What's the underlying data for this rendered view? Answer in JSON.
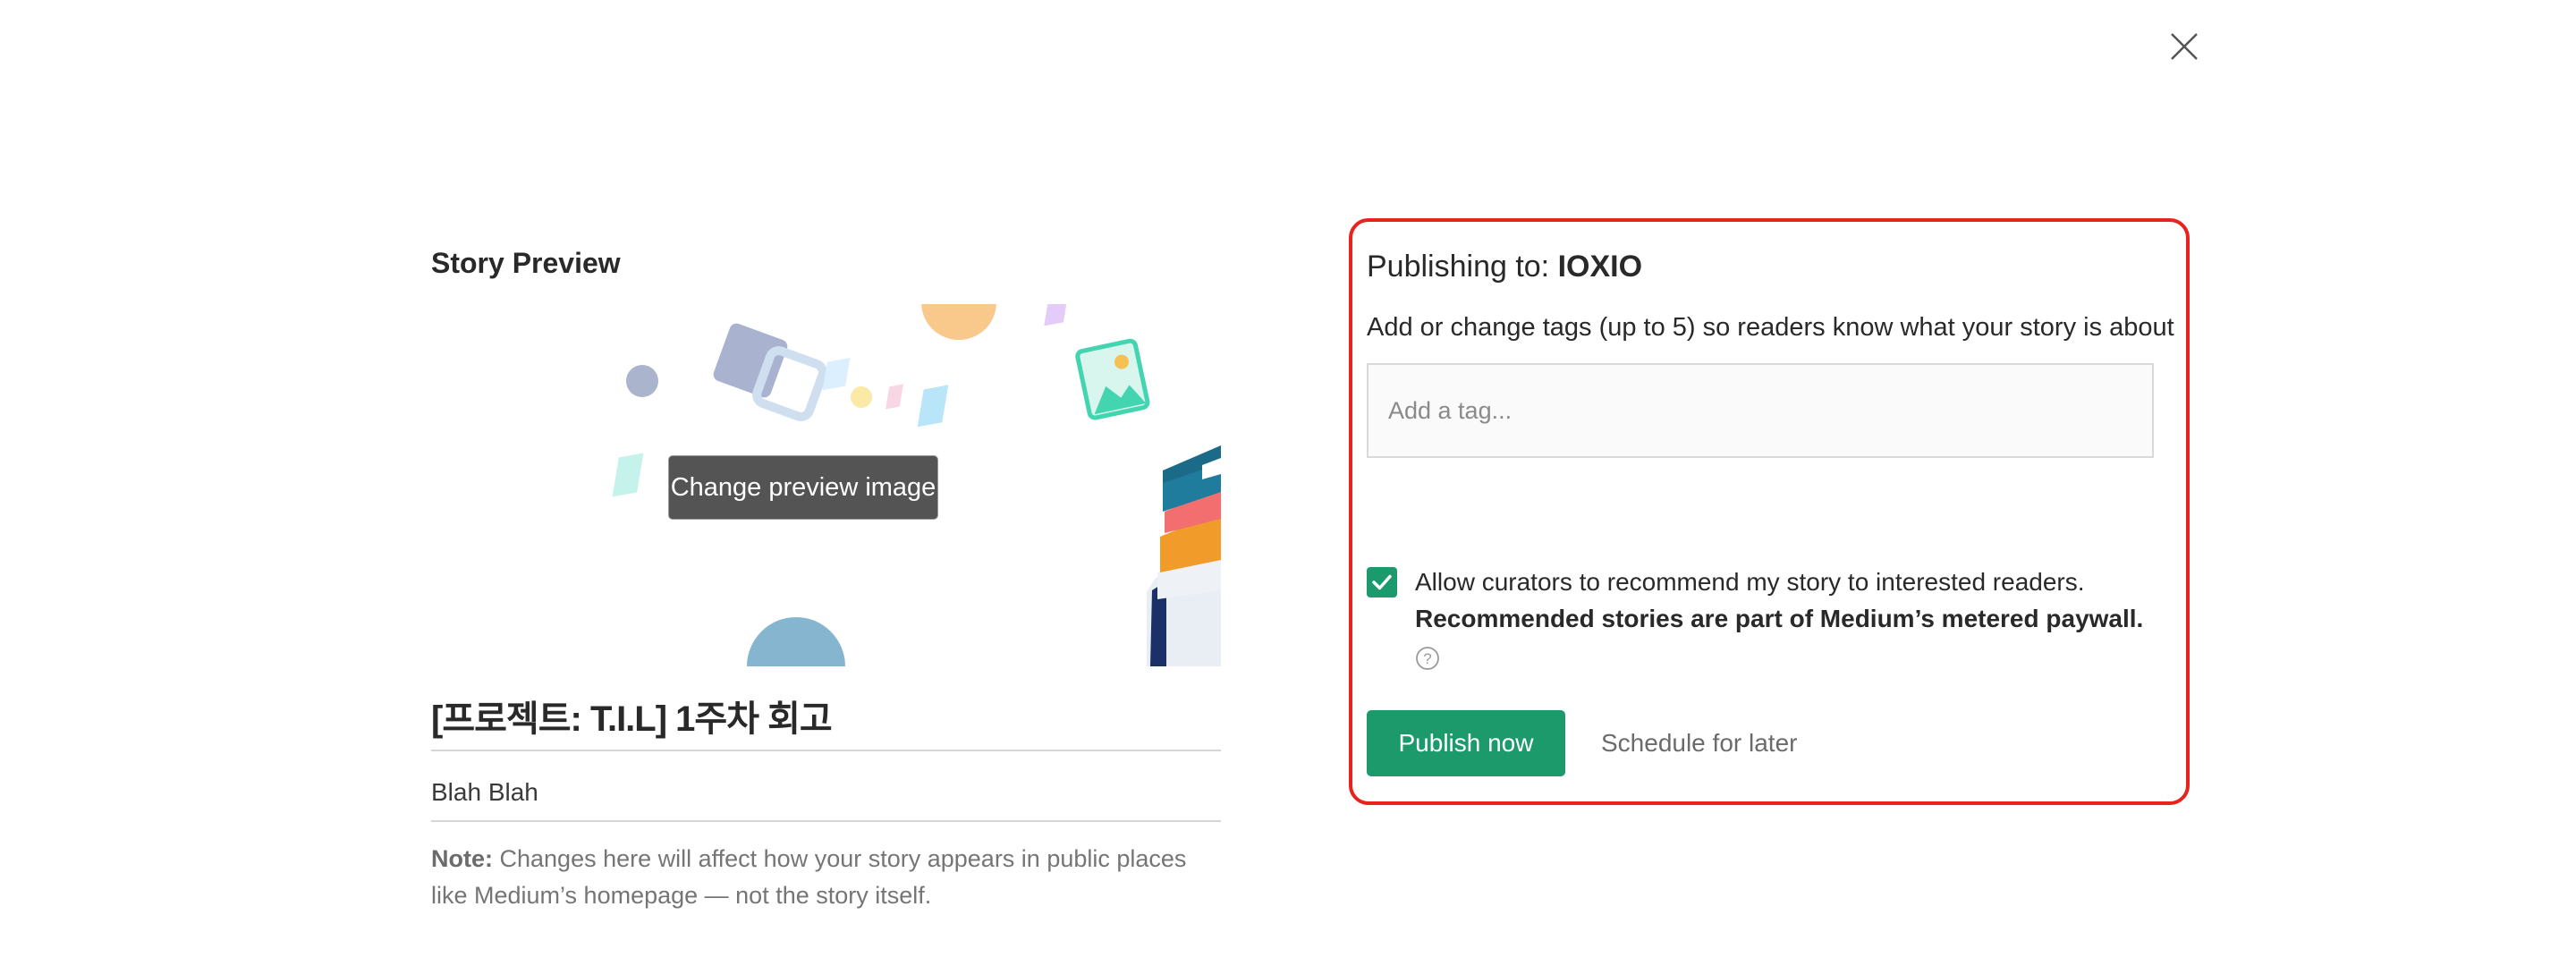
{
  "close": {
    "icon": "close-icon"
  },
  "preview": {
    "heading": "Story Preview",
    "change_image_label": "Change preview image",
    "title": "[프로젝트: T.I.L] 1주차 회고",
    "subtitle": "Blah Blah",
    "note_label": "Note:",
    "note_text": " Changes here will affect how your story appears in public places like Medium’s homepage — not the story itself."
  },
  "publishing": {
    "prefix": "Publishing to: ",
    "publication": "IOXIO",
    "tags_help": "Add or change tags (up to 5) so readers know what your story is about",
    "tag_placeholder": "Add a tag...",
    "curator_checked": true,
    "curator_text": "Allow curators to recommend my story to interested readers.",
    "curator_bold": "Recommended stories are part of Medium’s metered paywall.",
    "help_icon": "question-circle-icon",
    "publish_now_label": "Publish now",
    "schedule_label": "Schedule for later"
  },
  "colors": {
    "accent_green": "#1d9a6c",
    "highlight_border": "#e8231d",
    "dark_button": "#545454"
  }
}
